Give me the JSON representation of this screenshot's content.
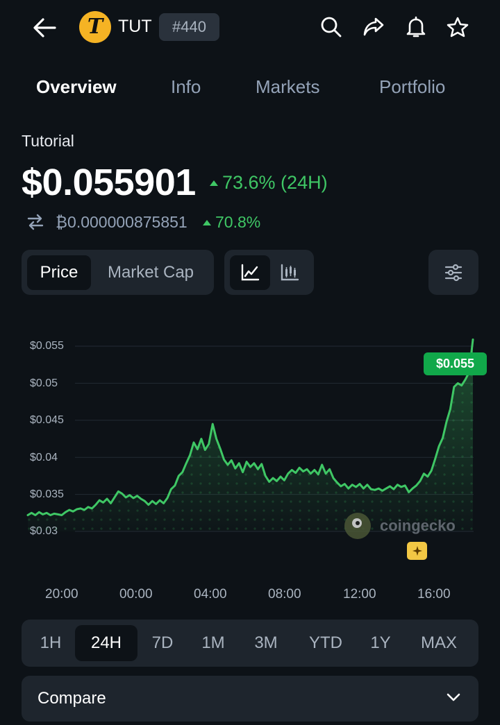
{
  "header": {
    "back_icon": "arrow-left-icon",
    "coin_logo_letter": "T",
    "symbol": "TUT",
    "rank": "#440",
    "actions": [
      "search-icon",
      "share-icon",
      "bell-icon",
      "star-icon"
    ]
  },
  "tabs": [
    {
      "label": "Overview",
      "active": true
    },
    {
      "label": "Info",
      "active": false
    },
    {
      "label": "Markets",
      "active": false
    },
    {
      "label": "Portfolio",
      "active": false
    }
  ],
  "coin": {
    "name": "Tutorial",
    "price": "$0.055901",
    "change_24h": "73.6% (24H)",
    "btc_price": "₿0.000000875851",
    "btc_change": "70.8%"
  },
  "toggles": {
    "price_label": "Price",
    "market_cap_label": "Market Cap",
    "line_chart_icon": "line-chart-icon",
    "candle_chart_icon": "candlestick-chart-icon",
    "settings_icon": "sliders-icon"
  },
  "chart_data": {
    "type": "line",
    "title": "",
    "xlabel": "",
    "ylabel": "",
    "y_tick_labels": [
      "$0.055",
      "$0.05",
      "$0.045",
      "$0.04",
      "$0.035",
      "$0.03"
    ],
    "y_ticks": [
      0.055,
      0.05,
      0.045,
      0.04,
      0.035,
      0.03
    ],
    "x_tick_labels": [
      "20:00",
      "00:00",
      "04:00",
      "08:00",
      "12:00",
      "16:00"
    ],
    "ylim": [
      0.03,
      0.055
    ],
    "grid": true,
    "line_color": "#3fc765",
    "series": [
      {
        "values": [
          0.0322,
          0.0325,
          0.0322,
          0.0326,
          0.0323,
          0.0325,
          0.0322,
          0.0324,
          0.0323,
          0.0322,
          0.0326,
          0.0329,
          0.0327,
          0.033,
          0.0331,
          0.0329,
          0.0333,
          0.0331,
          0.0336,
          0.0342,
          0.0339,
          0.0344,
          0.0338,
          0.0346,
          0.0354,
          0.0351,
          0.0346,
          0.0349,
          0.0345,
          0.0348,
          0.0344,
          0.0341,
          0.0336,
          0.0341,
          0.0337,
          0.0342,
          0.0338,
          0.0345,
          0.0357,
          0.0362,
          0.0375,
          0.038,
          0.0392,
          0.0403,
          0.042,
          0.0411,
          0.0425,
          0.041,
          0.0418,
          0.0445,
          0.0425,
          0.0412,
          0.0397,
          0.039,
          0.0396,
          0.0385,
          0.0392,
          0.038,
          0.0394,
          0.0387,
          0.0392,
          0.0384,
          0.0391,
          0.0375,
          0.0367,
          0.0372,
          0.0368,
          0.0374,
          0.0369,
          0.0378,
          0.0383,
          0.0379,
          0.0386,
          0.0381,
          0.0384,
          0.0378,
          0.0383,
          0.0377,
          0.039,
          0.0378,
          0.0384,
          0.0372,
          0.0366,
          0.0361,
          0.0364,
          0.0358,
          0.0363,
          0.036,
          0.0364,
          0.0358,
          0.0363,
          0.0357,
          0.0356,
          0.0358,
          0.0355,
          0.0358,
          0.0361,
          0.0357,
          0.0363,
          0.036,
          0.0362,
          0.0353,
          0.0358,
          0.0362,
          0.0368,
          0.0378,
          0.0374,
          0.0382,
          0.0398,
          0.0415,
          0.0426,
          0.0448,
          0.0465,
          0.0495,
          0.05,
          0.0497,
          0.0505,
          0.0515,
          0.0559
        ],
        "current_value_label": "$0.055"
      }
    ],
    "watermark": "coingecko"
  },
  "ranges": [
    {
      "label": "1H",
      "active": false
    },
    {
      "label": "24H",
      "active": true
    },
    {
      "label": "7D",
      "active": false
    },
    {
      "label": "1M",
      "active": false
    },
    {
      "label": "3M",
      "active": false
    },
    {
      "label": "YTD",
      "active": false
    },
    {
      "label": "1Y",
      "active": false
    },
    {
      "label": "MAX",
      "active": false
    }
  ],
  "compare": {
    "label": "Compare",
    "icon": "chevron-down-icon"
  },
  "colors": {
    "background": "#0d1217",
    "surface": "#1e252d",
    "positive": "#3fc765",
    "tag": "#11a84a",
    "coin_logo": "#f5b324"
  }
}
